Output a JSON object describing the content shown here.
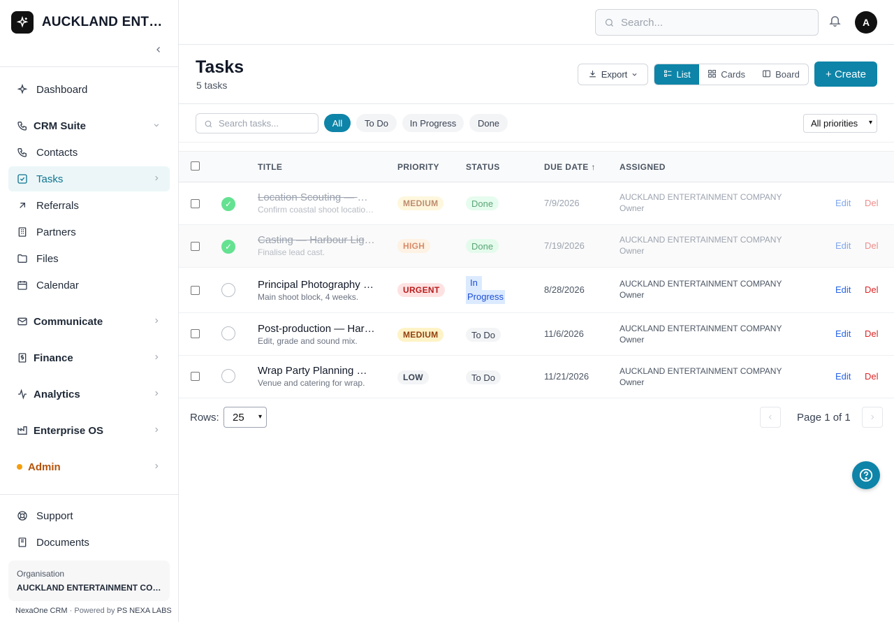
{
  "brand": {
    "name": "AUCKLAND ENTER..."
  },
  "sidebar": {
    "items": [
      {
        "label": "Dashboard"
      },
      {
        "label": "CRM Suite"
      },
      {
        "label": "Contacts"
      },
      {
        "label": "Tasks"
      },
      {
        "label": "Referrals"
      },
      {
        "label": "Partners"
      },
      {
        "label": "Files"
      },
      {
        "label": "Calendar"
      },
      {
        "label": "Communicate"
      },
      {
        "label": "Finance"
      },
      {
        "label": "Analytics"
      },
      {
        "label": "Enterprise OS"
      },
      {
        "label": "Admin"
      }
    ],
    "bottom": [
      {
        "label": "Support"
      },
      {
        "label": "Documents"
      }
    ],
    "org_caption": "Organisation",
    "org_name": "AUCKLAND ENTERTAINMENT COMPANY",
    "footer_app": "NexaOne CRM",
    "footer_sep": " · Powered by ",
    "footer_company": "PS NEXA LABS"
  },
  "topbar": {
    "search_placeholder": "Search...",
    "avatar_initial": "A"
  },
  "header": {
    "title": "Tasks",
    "subtitle": "5 tasks",
    "export_label": "Export",
    "views": [
      "List",
      "Cards",
      "Board"
    ],
    "create_label": "+ Create"
  },
  "filters": {
    "search_placeholder": "Search tasks...",
    "chips": [
      "All",
      "To Do",
      "In Progress",
      "Done"
    ],
    "priority_select": "All priorities"
  },
  "table": {
    "headers": [
      "TITLE",
      "PRIORITY",
      "STATUS",
      "DUE DATE ↑",
      "ASSIGNED"
    ],
    "rows": [
      {
        "title": "Location Scouting — Harbour Lights",
        "desc": "Confirm coastal shoot locations.",
        "priority": "MEDIUM",
        "status": "Done",
        "due": "7/9/2026",
        "assigned": "AUCKLAND ENTERTAINMENT COMPANY",
        "role": "Owner",
        "edit": "Edit",
        "del": "Del"
      },
      {
        "title": "Casting — Harbour Lights",
        "desc": "Finalise lead cast.",
        "priority": "HIGH",
        "status": "Done",
        "due": "7/19/2026",
        "assigned": "AUCKLAND ENTERTAINMENT COMPANY",
        "role": "Owner",
        "edit": "Edit",
        "del": "Del"
      },
      {
        "title": "Principal Photography — Harbour Lights",
        "desc": "Main shoot block, 4 weeks.",
        "priority": "URGENT",
        "status_1": "In",
        "status_2": "Progress",
        "due": "8/28/2026",
        "assigned": "AUCKLAND ENTERTAINMENT COMPANY",
        "role": "Owner",
        "edit": "Edit",
        "del": "Del"
      },
      {
        "title": "Post-production — Harbour Lights",
        "desc": "Edit, grade and sound mix.",
        "priority": "MEDIUM",
        "status": "To Do",
        "due": "11/6/2026",
        "assigned": "AUCKLAND ENTERTAINMENT COMPANY",
        "role": "Owner",
        "edit": "Edit",
        "del": "Del"
      },
      {
        "title": "Wrap Party Planning — Harbour Lights",
        "desc": "Venue and catering for wrap.",
        "priority": "LOW",
        "status": "To Do",
        "due": "11/21/2026",
        "assigned": "AUCKLAND ENTERTAINMENT COMPANY",
        "role": "Owner",
        "edit": "Edit",
        "del": "Del"
      }
    ]
  },
  "pager": {
    "rows_label": "Rows:",
    "rows_value": "25",
    "page_text": "Page 1 of 1"
  },
  "colors": {
    "accent": "#0e84a8",
    "active_nav_bg": "#ecf6f8"
  }
}
